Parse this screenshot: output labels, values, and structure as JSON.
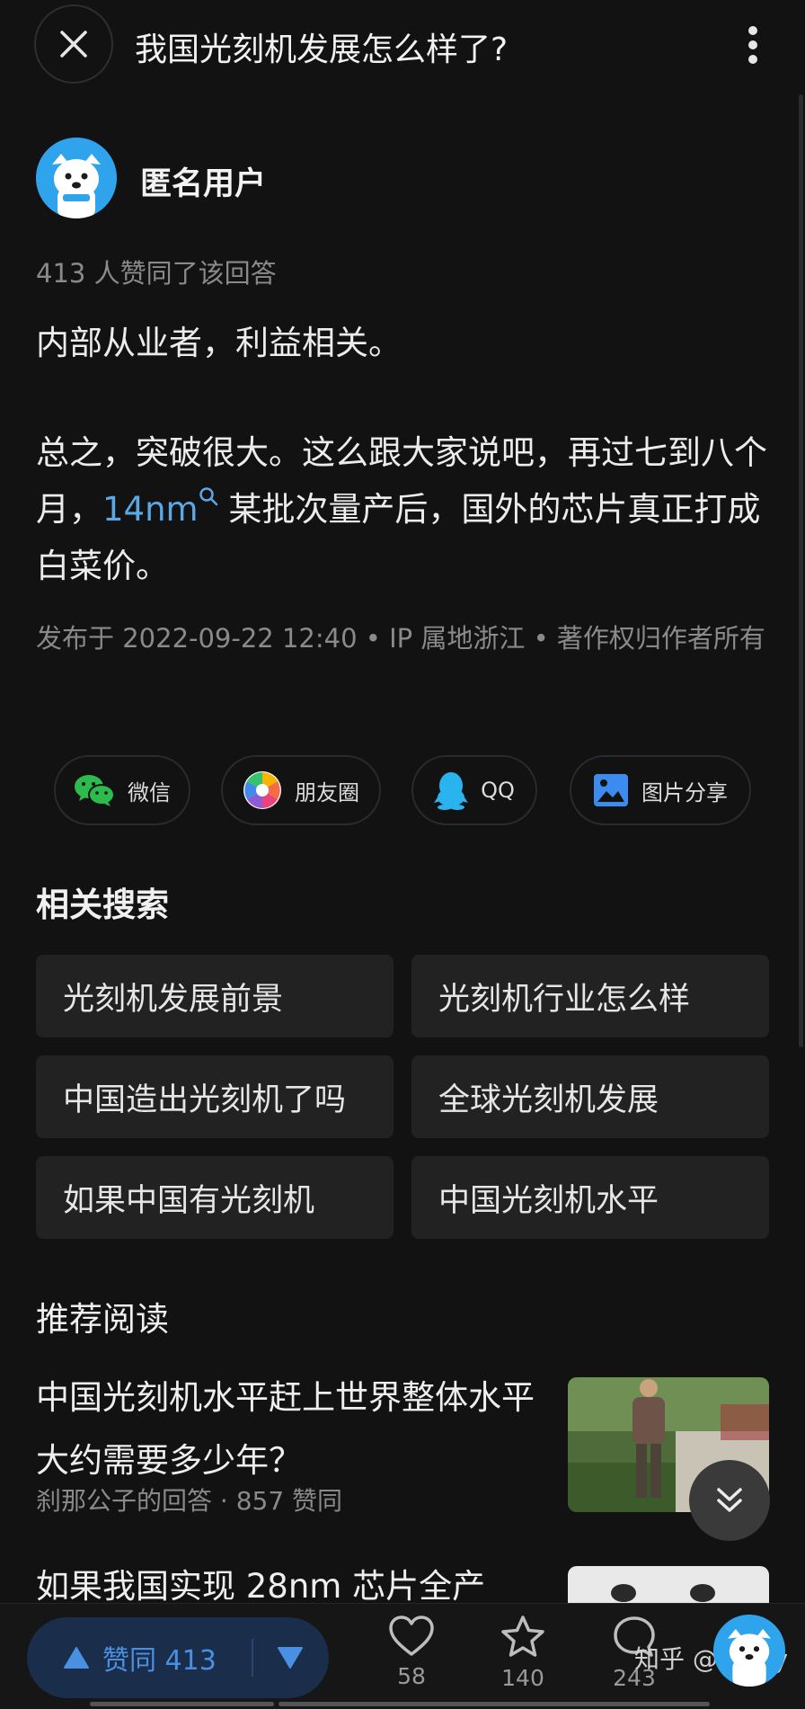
{
  "header": {
    "title": "我国光刻机发展怎么样了?"
  },
  "author": {
    "name": "匿名用户"
  },
  "answer": {
    "agree_text": "413 人赞同了该回答",
    "para1": "内部从业者，利益相关。",
    "para2_before": "总之，突破很大。这么跟大家说吧，再过七到八个月，",
    "para2_link": "14nm",
    "para2_after": " 某批次量产后，国外的芯片真正打成白菜价。",
    "meta": "发布于 2022-09-22 12:40 • IP 属地浙江 • 著作权归作者所有"
  },
  "share": {
    "wechat": "微信",
    "moments": "朋友圈",
    "qq": "QQ",
    "image": "图片分享"
  },
  "related": {
    "title": "相关搜索",
    "items": [
      "光刻机发展前景",
      "光刻机行业怎么样",
      "中国造出光刻机了吗",
      "全球光刻机发展",
      "如果中国有光刻机",
      "中国光刻机水平"
    ]
  },
  "recommend": {
    "title": "推荐阅读",
    "items": [
      {
        "title": "中国光刻机水平赶上世界整体水平大约需要多少年？",
        "meta": "刹那公子的回答 · 857 赞同"
      },
      {
        "title": "如果我国实现 28nm 芯片全产",
        "meta": ""
      }
    ]
  },
  "bottom_bar": {
    "vote_up_label": "赞同 413",
    "like_count": "58",
    "favorite_count": "140",
    "comment_count": "243",
    "watermark": "知乎 @ccccy"
  },
  "colors": {
    "background": "#121212",
    "link": "#5aa8e6",
    "vote_accent": "#4a90e2",
    "vote_pill": "#1a2d4a",
    "chip": "#222222"
  },
  "icons": [
    "close-icon",
    "more-vertical-icon",
    "wechat-icon",
    "moments-icon",
    "qq-icon",
    "image-share-icon",
    "search-icon",
    "chevron-double-down-icon",
    "triangle-up-icon",
    "triangle-down-icon",
    "heart-icon",
    "star-icon",
    "comment-icon"
  ]
}
